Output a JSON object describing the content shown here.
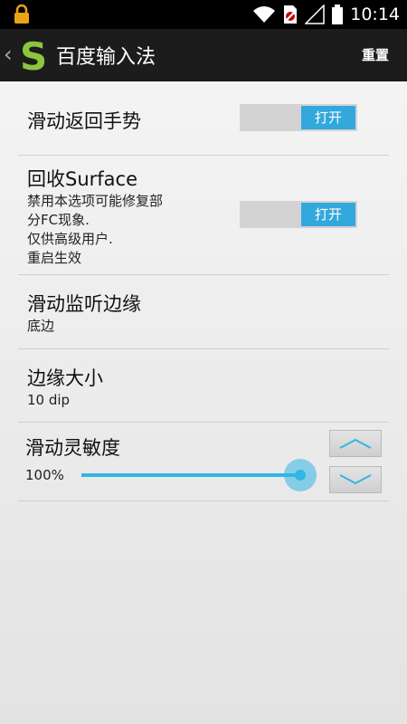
{
  "status_bar": {
    "time": "10:14"
  },
  "action_bar": {
    "title": "百度输入法",
    "reset_label": "重置"
  },
  "prefs": [
    {
      "title": "滑动返回手势",
      "toggle": "打开"
    },
    {
      "title": "回收Surface",
      "summary": [
        "禁用本选项可能修复部",
        "分FC现象.",
        "仅供高级用户.",
        "重启生效"
      ],
      "toggle": "打开"
    },
    {
      "title": "滑动监听边缘",
      "summary": "底边"
    },
    {
      "title": "边缘大小",
      "summary": "10 dip"
    },
    {
      "title": "滑动灵敏度",
      "value_label": "100%",
      "value": 1.0
    }
  ],
  "icons": {
    "status": [
      "lock-icon",
      "wifi-icon",
      "sim-icon",
      "signal-icon",
      "battery-icon"
    ],
    "action": [
      "back-chevron-icon",
      "app-logo-icon"
    ],
    "stepper": [
      "chevron-up-icon",
      "chevron-down-icon"
    ]
  },
  "colors": {
    "accent": "#33b5e5",
    "toggle_on": "#33a8dc",
    "logo": "#8cc63f"
  }
}
